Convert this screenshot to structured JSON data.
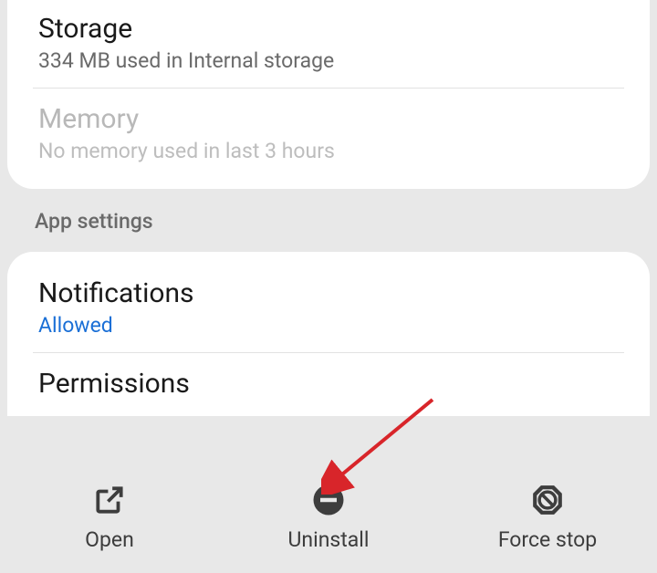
{
  "usage": {
    "storage": {
      "title": "Storage",
      "subtitle": "334 MB used in Internal storage"
    },
    "memory": {
      "title": "Memory",
      "subtitle": "No memory used in last 3 hours"
    }
  },
  "section_header": "App settings",
  "settings": {
    "notifications": {
      "title": "Notifications",
      "status": "Allowed"
    },
    "permissions": {
      "title": "Permissions"
    }
  },
  "actions": {
    "open": "Open",
    "uninstall": "Uninstall",
    "force_stop": "Force stop"
  }
}
